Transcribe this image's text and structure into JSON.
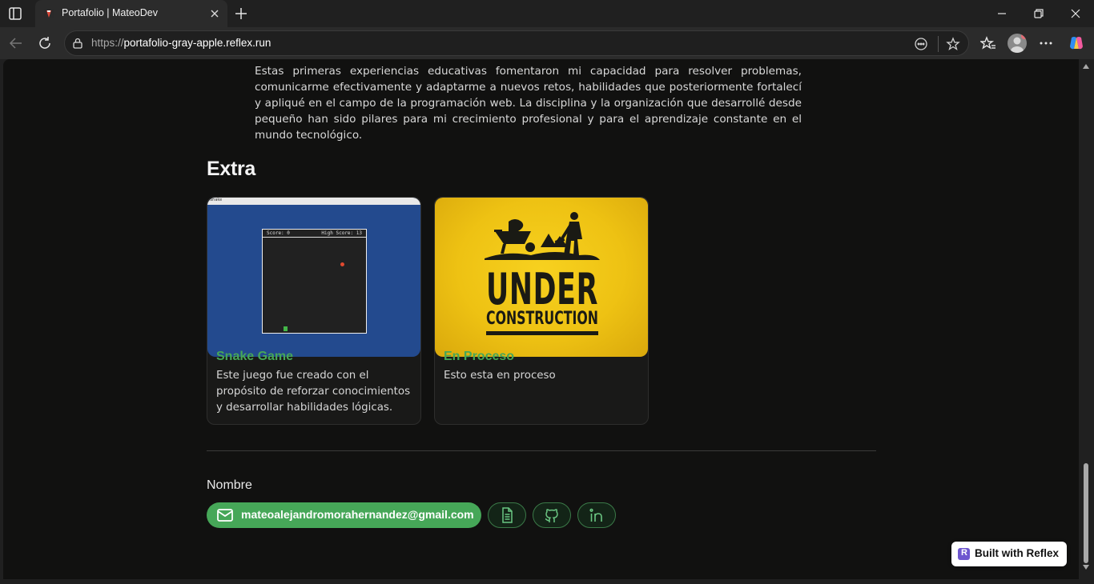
{
  "browser": {
    "tab_title": "Portafolio | MateoDev",
    "url_prefix": "https://",
    "url_host": "portafolio-gray-apple.reflex.run",
    "icons": [
      "tab-actions-icon",
      "favicon",
      "close-icon",
      "plus-icon",
      "minimize-icon",
      "restore-icon",
      "close-window-icon",
      "back-icon",
      "refresh-icon",
      "lock-icon",
      "reader-icon",
      "star-icon",
      "favorites-icon",
      "profile-icon",
      "more-icon",
      "copilot-icon"
    ]
  },
  "page": {
    "intro_paragraph": "Estas primeras experiencias educativas fomentaron mi capacidad para resolver problemas, comunicarme efectivamente y adaptarme a nuevos retos, habilidades que posteriormente fortalecí y apliqué en el campo de la programación web. La disciplina y la organización que desarrollé desde pequeño han sido pilares para mi crecimiento profesional y para el aprendizaje constante en el mundo tecnológico.",
    "section_title": "Extra",
    "projects": [
      {
        "title": "Snake Game",
        "description": "Este juego fue creado con el propósito de reforzar conocimientos y desarrollar habilidades lógicas.",
        "thumbnail": {
          "window_caption": "Snake",
          "score_text": "Score: 0",
          "high_score_text": "High Score: 13"
        }
      },
      {
        "title": "En Proceso",
        "description": "Esto esta en proceso",
        "thumbnail": {
          "line1": "UNDER",
          "line2": "CONSTRUCTION"
        }
      }
    ],
    "footer": {
      "name_label": "Nombre",
      "email": "mateoalejandromorahernandez@gmail.com",
      "icon_buttons": [
        "document-icon",
        "github-icon",
        "linkedin-icon"
      ]
    },
    "badge": "Built with Reflex",
    "badge_logo": "R"
  },
  "colors": {
    "accent_green": "#46a758",
    "page_bg": "#111110",
    "card_bg": "#191918",
    "chrome_bg": "#202020"
  }
}
